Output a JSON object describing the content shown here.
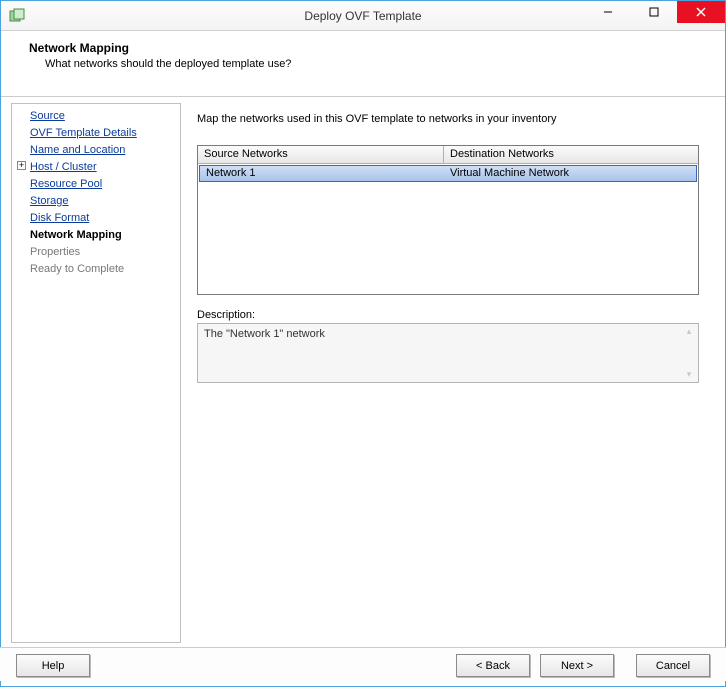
{
  "window": {
    "title": "Deploy OVF Template"
  },
  "header": {
    "title": "Network Mapping",
    "subtitle": "What networks should the deployed template use?"
  },
  "nav": {
    "items": [
      {
        "label": "Source",
        "state": "link"
      },
      {
        "label": "OVF Template Details",
        "state": "link"
      },
      {
        "label": "Name and Location",
        "state": "link"
      },
      {
        "label": "Host / Cluster",
        "state": "link",
        "expandable": true
      },
      {
        "label": "Resource Pool",
        "state": "link"
      },
      {
        "label": "Storage",
        "state": "link"
      },
      {
        "label": "Disk Format",
        "state": "link"
      },
      {
        "label": "Network Mapping",
        "state": "current"
      },
      {
        "label": "Properties",
        "state": "disabled"
      },
      {
        "label": "Ready to Complete",
        "state": "disabled"
      }
    ]
  },
  "main": {
    "instruction": "Map the networks used in this OVF template to networks in your inventory",
    "columns": {
      "source": "Source Networks",
      "destination": "Destination Networks"
    },
    "rows": [
      {
        "source": "Network 1",
        "destination": "Virtual Machine Network"
      }
    ],
    "description_label": "Description:",
    "description_text": "The \"Network 1\" network"
  },
  "footer": {
    "help": "Help",
    "back": "< Back",
    "next": "Next >",
    "cancel": "Cancel"
  }
}
